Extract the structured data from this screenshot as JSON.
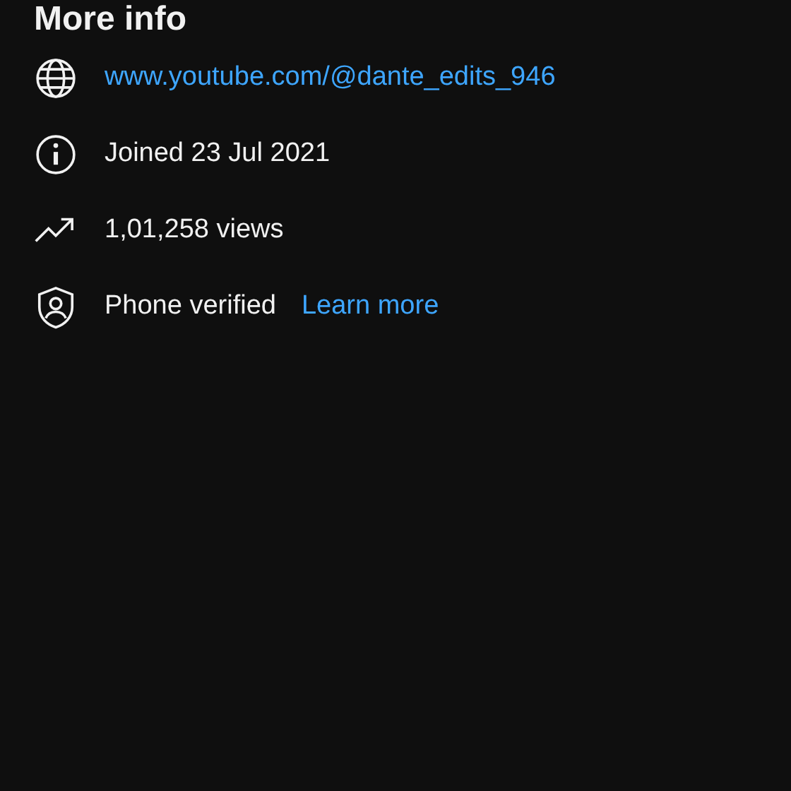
{
  "heading": "More info",
  "rows": [
    {
      "kind": "website",
      "text": "www.youtube.com/@dante_edits_946"
    },
    {
      "kind": "joined",
      "text": "Joined 23 Jul 2021"
    },
    {
      "kind": "views",
      "text": "1,01,258 views"
    },
    {
      "kind": "verification",
      "text": "Phone verified",
      "link": "Learn more"
    }
  ]
}
